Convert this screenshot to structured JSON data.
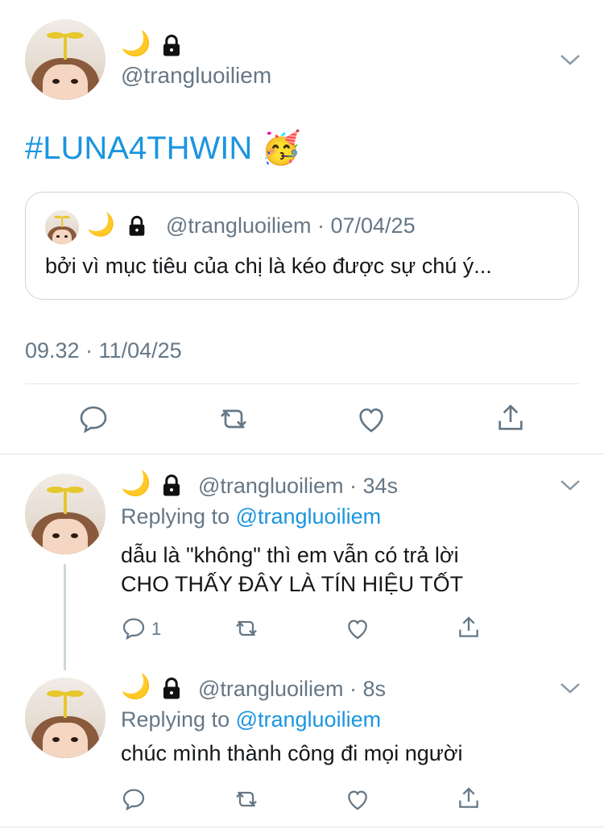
{
  "main_tweet": {
    "display_name_emoji": "🌙",
    "handle": "@trangluoiliem",
    "hashtag": "#LUNA4THWIN",
    "hashtag_emoji": "🥳",
    "quoted": {
      "display_name_emoji": "🌙",
      "handle": "@trangluoiliem",
      "date": "· 07/04/25",
      "text": "bởi vì mục tiêu của chị là kéo được sự chú ý..."
    },
    "timestamp": "09.32 · 11/04/25"
  },
  "replies": [
    {
      "display_name_emoji": "🌙",
      "handle": "@trangluoiliem",
      "age": "· 34s",
      "replying_prefix": "Replying to ",
      "replying_handle": "@trangluoiliem",
      "text_line1": "dẫu là \"không\" thì em vẫn có trả lời",
      "text_line2": "CHO THẤY ĐÂY LÀ TÍN HIỆU TỐT",
      "reply_count": "1"
    },
    {
      "display_name_emoji": "🌙",
      "handle": "@trangluoiliem",
      "age": "· 8s",
      "replying_prefix": "Replying to ",
      "replying_handle": "@trangluoiliem",
      "text_line1": "chúc mình thành công đi mọi người",
      "reply_count": ""
    }
  ],
  "icons": {
    "reply": "reply-icon",
    "retweet": "retweet-icon",
    "like": "heart-icon",
    "share": "share-icon",
    "lock": "lock-icon",
    "chevron": "chevron-down-icon"
  },
  "colors": {
    "link_blue": "#1b95e0",
    "secondary_gray": "#657786",
    "divider": "#e1e8ed"
  }
}
